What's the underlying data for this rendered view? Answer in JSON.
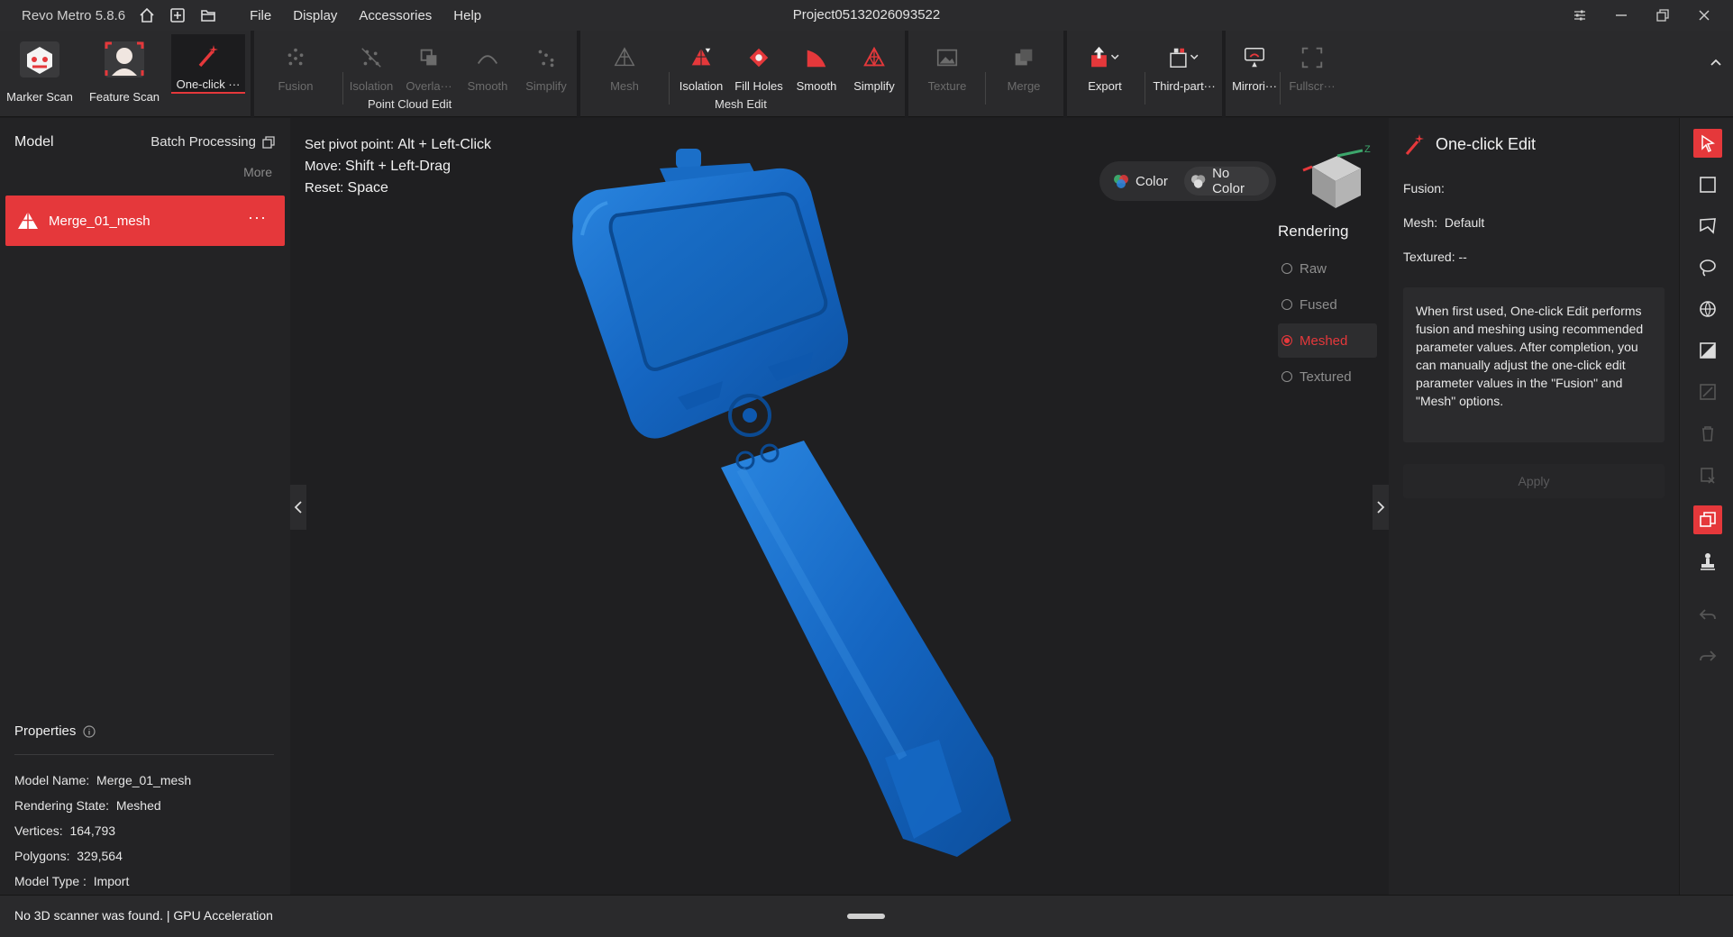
{
  "titlebar": {
    "app_name": "Revo Metro 5.8.6",
    "menus": [
      "File",
      "Display",
      "Accessories",
      "Help"
    ],
    "project_title": "Project05132026093522"
  },
  "toolbar": {
    "marker_scan": "Marker Scan",
    "feature_scan": "Feature Scan",
    "one_click": "One-click ···",
    "fusion": "Fusion",
    "isolation_pc": "Isolation",
    "overlap": "Overla···",
    "smooth_pc": "Smooth",
    "simplify_pc": "Simplify",
    "point_cloud_group": "Point Cloud Edit",
    "mesh": "Mesh",
    "isolation_mesh": "Isolation",
    "fill_holes": "Fill Holes",
    "smooth_mesh": "Smooth",
    "simplify_mesh": "Simplify",
    "mesh_group": "Mesh Edit",
    "texture": "Texture",
    "merge": "Merge",
    "export": "Export",
    "third_party": "Third-part···",
    "mirroring": "Mirrori···",
    "fullscreen": "Fullscr···"
  },
  "left_panel": {
    "title": "Model",
    "batch_processing": "Batch Processing",
    "more": "More",
    "model_item": "Merge_01_mesh",
    "model_item_more": "···",
    "properties_title": "Properties",
    "properties": [
      {
        "label": "Model Name:",
        "value": "Merge_01_mesh"
      },
      {
        "label": "Rendering State:",
        "value": "Meshed"
      },
      {
        "label": "Vertices:",
        "value": "164,793"
      },
      {
        "label": "Polygons:",
        "value": "329,564"
      },
      {
        "label": "Model Type :",
        "value": "Import"
      }
    ]
  },
  "viewport": {
    "hints": [
      {
        "label": "Set pivot point: ",
        "key": "Alt + Left-Click"
      },
      {
        "label": "Move: ",
        "key": "Shift + Left-Drag"
      },
      {
        "label": "Reset: ",
        "key": "Space"
      }
    ],
    "color_options": [
      "Color",
      "No Color"
    ],
    "rendering_title": "Rendering",
    "rendering_options": [
      "Raw",
      "Fused",
      "Meshed",
      "Textured"
    ],
    "rendering_selected": "Meshed",
    "axis_label": "Z",
    "model_color": "#1a6fc4"
  },
  "right_panel": {
    "title": "One-click Edit",
    "fusion_label": "Fusion:",
    "mesh_label": "Mesh:",
    "mesh_value": "Default",
    "textured_label": "Textured: --",
    "info": "When first used, One-click Edit performs fusion and meshing using recommended parameter values. After completion, you can manually adjust the one-click edit parameter values in the \"Fusion\" and \"Mesh\" options.",
    "apply": "Apply"
  },
  "statusbar": {
    "text": "No 3D scanner was found.  | GPU Acceleration"
  },
  "colors": {
    "accent": "#e5383b",
    "background": "#1d1d1f"
  }
}
